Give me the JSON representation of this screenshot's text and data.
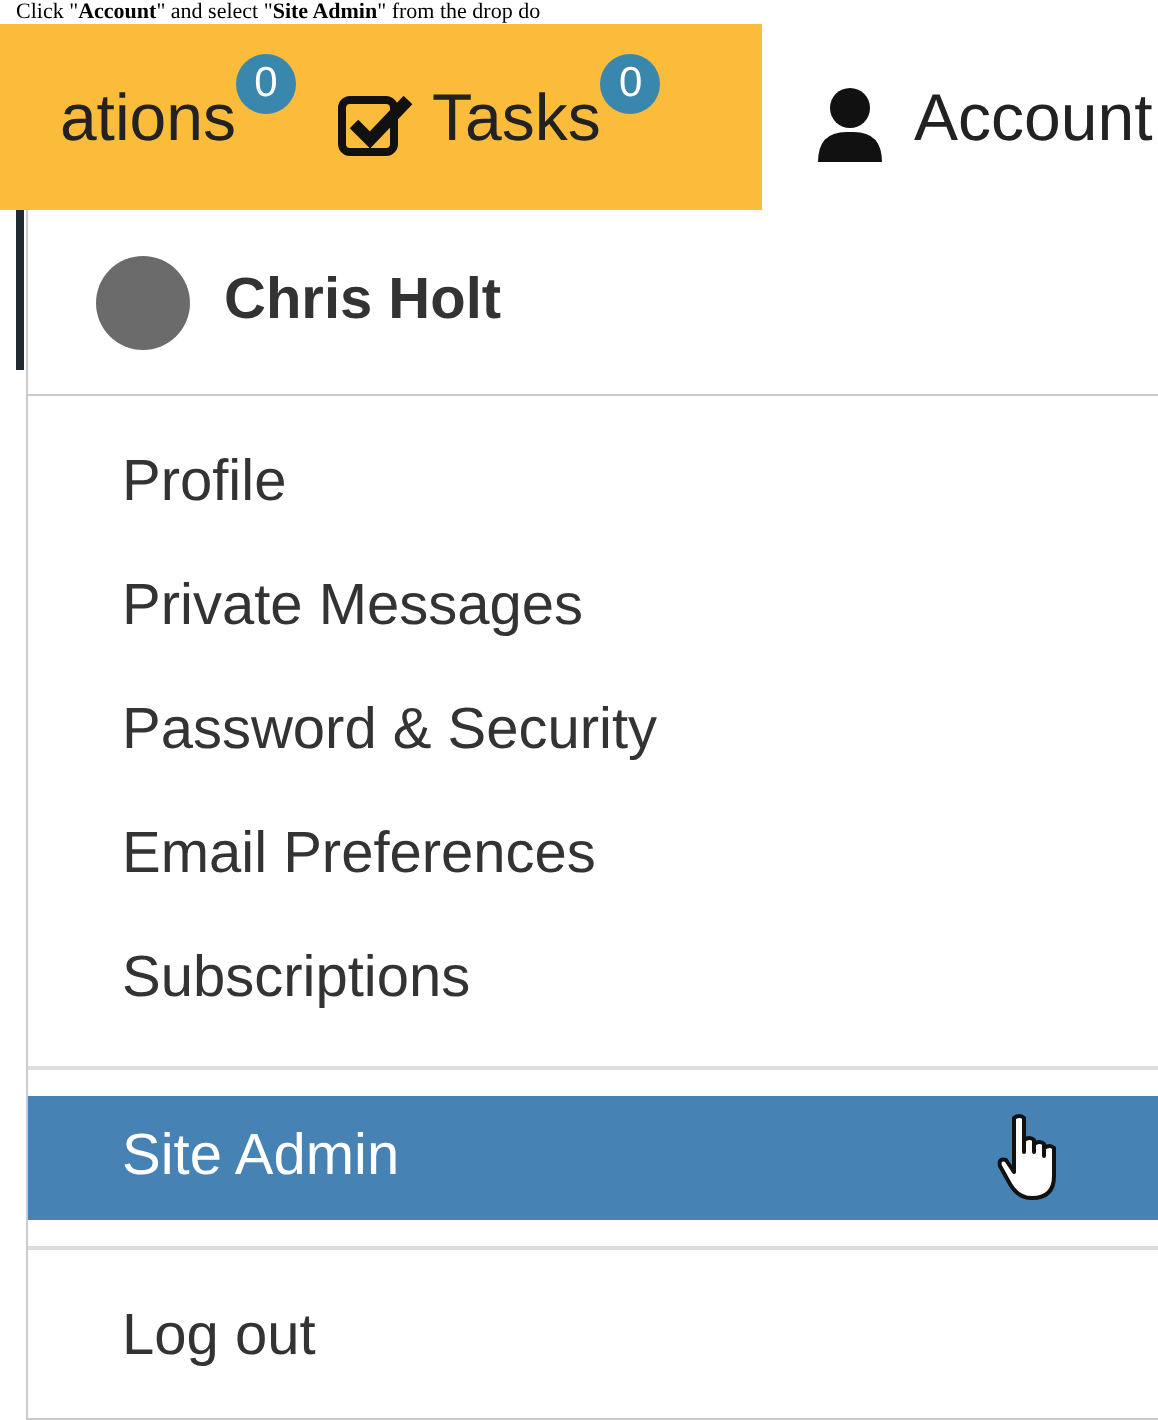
{
  "instruction": "Click \"**Account**\" and select \"**Site Admin**\" from the drop do",
  "nav": [
    {
      "label": "ations",
      "badge": "0",
      "kind": "text",
      "selected": false
    },
    {
      "label": "Tasks",
      "badge": "0",
      "kind": "check",
      "selected": false
    },
    {
      "label": "Account",
      "kind": "user",
      "selected": true
    }
  ],
  "dropdown": {
    "user_name": "Chris Holt",
    "groups": [
      [
        {
          "label": "Profile",
          "selected": false
        },
        {
          "label": "Private Messages",
          "selected": false
        },
        {
          "label": "Password & Security",
          "selected": false
        },
        {
          "label": "Email Preferences",
          "selected": false
        },
        {
          "label": "Subscriptions",
          "selected": false
        }
      ],
      [
        {
          "label": "Site Admin",
          "selected": true
        }
      ],
      [
        {
          "label": "Log out",
          "selected": false
        }
      ]
    ]
  }
}
